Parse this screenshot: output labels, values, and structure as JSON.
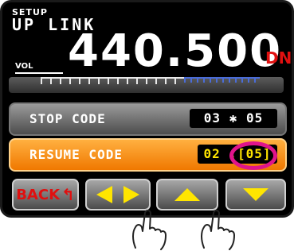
{
  "header": {
    "setup": "SETUP",
    "mode": "UP LINK",
    "vol": "VOL",
    "frequency": "440.500",
    "mode_badge": "DN"
  },
  "rows": {
    "stop_code": {
      "label": "STOP CODE",
      "value": "03 ✱ 05"
    },
    "resume_code": {
      "label": "RESUME CODE",
      "value": "02 :[05]"
    }
  },
  "buttons": {
    "back": "BACK"
  },
  "colors": {
    "accent_orange": "#f07800",
    "highlight_magenta": "#e0148c",
    "button_yellow": "#ffe500",
    "warning_red": "#e01010"
  },
  "icons": [
    "left-right-arrows-icon",
    "up-triangle-icon",
    "down-triangle-icon",
    "back-arrow-icon",
    "finger-tap-icon"
  ]
}
